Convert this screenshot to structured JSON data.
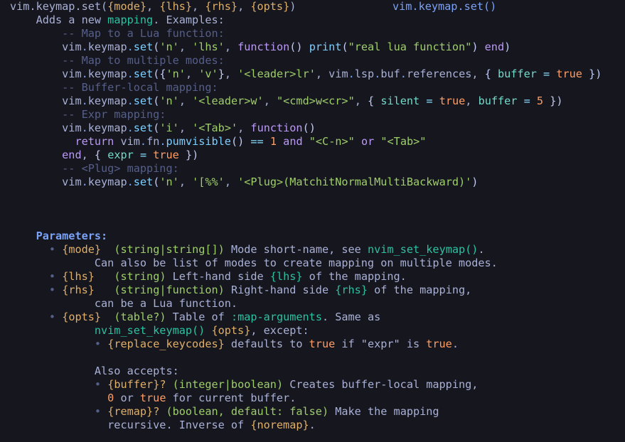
{
  "window": {
    "background": "#16161e",
    "foreground": "#a9b1d6",
    "kind": "neovim-help-buffer"
  },
  "palette": {
    "foreground": "#a9b1d6",
    "title": "#7aa2f7",
    "heading": "#7aa2f7",
    "comment": "#565f89",
    "string": "#9ece6a",
    "function": "#7dcfff",
    "keyword": "#bb9af7",
    "number": "#ff9e64",
    "boolean": "#ff9e64",
    "parameter": "#e0af68",
    "link": "#2ac3a2",
    "type": "#9ece6a",
    "field": "#73daca",
    "operator": "#89ddff",
    "brace": "#c0caf5"
  },
  "header": {
    "signature": "vim.keymap.set({mode}, {lhs}, {rhs}, {opts})",
    "signature_name": "vim.keymap.set(",
    "signature_mode": "{mode}",
    "signature_comma1": ", ",
    "signature_lhs": "{lhs}",
    "signature_comma2": ", ",
    "signature_rhs": "{rhs}",
    "signature_comma3": ", ",
    "signature_opts": "{opts}",
    "signature_close": ")",
    "tag": "vim.keymap.set()"
  },
  "description": {
    "lead_1": "Adds a new ",
    "lead_link": "mapping",
    "lead_2": ". Examples:"
  },
  "examples": [
    {
      "comment": "-- Map to a Lua function:",
      "code": "vim.keymap.set('n', 'lhs', function() print(\"real lua function\") end)"
    },
    {
      "comment": "-- Map to multiple modes:",
      "code": "vim.keymap.set({'n', 'v'}, '<leader>lr', vim.lsp.buf.references, { buffer = true })"
    },
    {
      "comment": "-- Buffer-local mapping:",
      "code": "vim.keymap.set('n', '<leader>w', \"<cmd>w<cr>\", { silent = true, buffer = 5 })"
    },
    {
      "comment": "-- Expr mapping:",
      "code": "vim.keymap.set('i', '<Tab>', function()"
    },
    {
      "comment": "-- <Plug> mapping:",
      "code": "vim.keymap.set('n', '[%%', '<Plug>(MatchitNormalMultiBackward)')"
    }
  ],
  "expr_body": {
    "return_kw": "return",
    "call": "vim.fn.pumvisible()",
    "eq": "==",
    "one": "1",
    "and_kw": "and",
    "str_cn": "\"<C-n>\"",
    "or_kw": "or",
    "str_tab": "\"<Tab>\"",
    "end_line": "end, { expr = true })"
  },
  "parameters_heading": "Parameters:",
  "parameters": [
    {
      "bullet": "•",
      "name": "{mode}",
      "type": "(string|string[])",
      "desc_1": " Mode short-name, see ",
      "link": "nvim_set_keymap()",
      "desc_2": ".",
      "cont": "Can also be list of modes to create mapping on multiple modes."
    },
    {
      "bullet": "•",
      "name": "{lhs}",
      "type": "(string)",
      "desc_1": " Left-hand side ",
      "link": "{lhs}",
      "desc_2": " of the mapping.",
      "cont": ""
    },
    {
      "bullet": "•",
      "name": "{rhs}",
      "type": "(string|function)",
      "desc_1": " Right-hand side ",
      "link": "{rhs}",
      "desc_2": " of the mapping,",
      "cont": "can be a Lua function."
    },
    {
      "bullet": "•",
      "name": "{opts}",
      "type": "(table?)",
      "desc_1": " Table of ",
      "link": ":map-arguments",
      "desc_2": ". Same as",
      "cont": ""
    }
  ],
  "opts_detail": {
    "link": "nvim_set_keymap()",
    "param": "{opts}",
    "tail": ", except:",
    "sub_bullet": "•",
    "sub_name": "{replace_keycodes}",
    "sub_text_1": " defaults to ",
    "sub_true": "true",
    "sub_text_2": " if \"expr\" is ",
    "sub_true2": "true",
    "sub_text_3": "."
  },
  "also_accepts": {
    "heading": "Also accepts:",
    "items": [
      {
        "bullet": "•",
        "name": "{buffer}?",
        "type": "(integer|boolean)",
        "desc": " Creates buffer-local mapping,",
        "cont_num": "0",
        "cont_1": " or ",
        "cont_true": "true",
        "cont_2": " for current buffer."
      },
      {
        "bullet": "•",
        "name": "{remap}?",
        "type_open": "(boolean, default: ",
        "type_false": "false",
        "type_close": ")",
        "desc": " Make the mapping",
        "cont_1": "recursive. Inverse of ",
        "cont_param": "{noremap}",
        "cont_2": "."
      }
    ]
  }
}
